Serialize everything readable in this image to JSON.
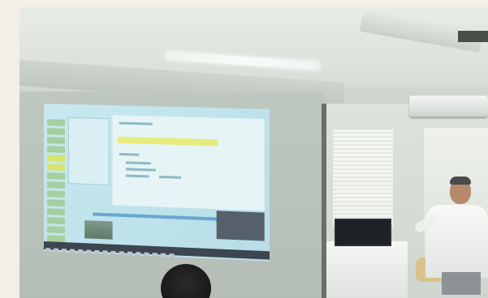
{
  "scene": {
    "description_visible_text": "",
    "projected_screen": {
      "sidebar_items": 14,
      "taskbar_icons": 16
    }
  }
}
